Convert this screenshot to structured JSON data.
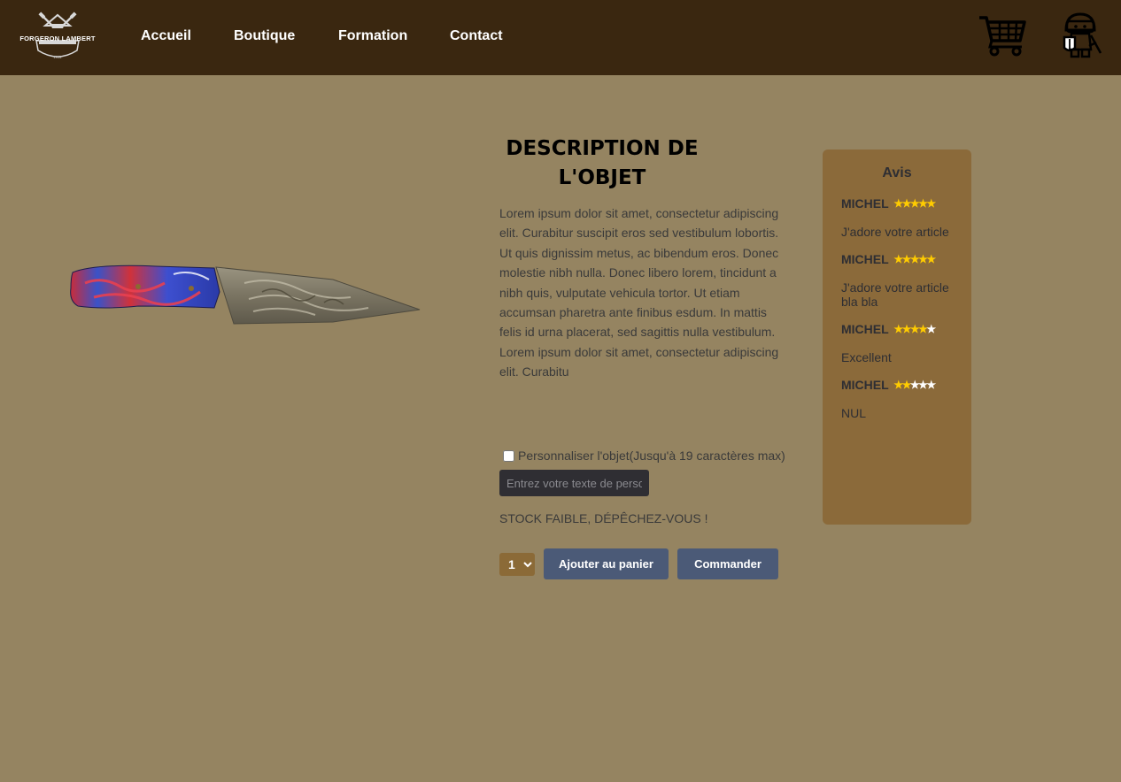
{
  "header": {
    "logo_text": "FORGERON LAMBERT",
    "nav": [
      "Accueil",
      "Boutique",
      "Formation",
      "Contact"
    ],
    "cart_icon": "shopping-cart-icon",
    "account_icon": "knight-avatar-icon"
  },
  "product": {
    "image_icon": "damascus-knife-image",
    "title": "DESCRIPTION DE L'OBJET",
    "description": "Lorem ipsum dolor sit amet, consectetur adipiscing elit. Curabitur suscipit eros sed vestibulum lobortis. Ut quis dignissim metus, ac bibendum eros. Donec molestie nibh nulla. Donec libero lorem, tincidunt a nibh quis, vulputate vehicula tortor. Ut etiam accumsan pharetra ante finibus esdum. In mattis felis id urna placerat, sed sagittis nulla vestibulum. Lorem ipsum dolor sit amet, consectetur adipiscing elit. Curabitu",
    "personalize_label": "Personnaliser l'objet(Jusqu'à 19 caractères max)",
    "personalize_checked": false,
    "personalize_placeholder": "Entrez votre texte de personnalisation",
    "personalize_value": "",
    "stock_text": "STOCK FAIBLE, DÉPÊCHEZ-VOUS !",
    "quantity": "1",
    "add_to_cart_label": "Ajouter au panier",
    "order_label": "Commander"
  },
  "reviews": {
    "title": "Avis",
    "items": [
      {
        "author": "MICHEL",
        "rating": 5,
        "stars_text": "★★★★★",
        "text": "J'adore votre article"
      },
      {
        "author": "MICHEL",
        "rating": 5,
        "stars_text": "★★★★★",
        "text": "J'adore votre article bla bla"
      },
      {
        "author": "MICHEL",
        "rating": 4,
        "stars_text": "★★★★★",
        "text": "Excellent"
      },
      {
        "author": "MICHEL",
        "rating": 2,
        "stars_text": "★★★★★",
        "text": "NUL"
      }
    ]
  },
  "colors": {
    "header_bg": "#3a2710",
    "page_bg": "#958461",
    "reviews_bg": "#8b6a3a",
    "button_bg": "#4b5a77",
    "star_on": "#ffcc00",
    "star_off": "#ffffff"
  }
}
